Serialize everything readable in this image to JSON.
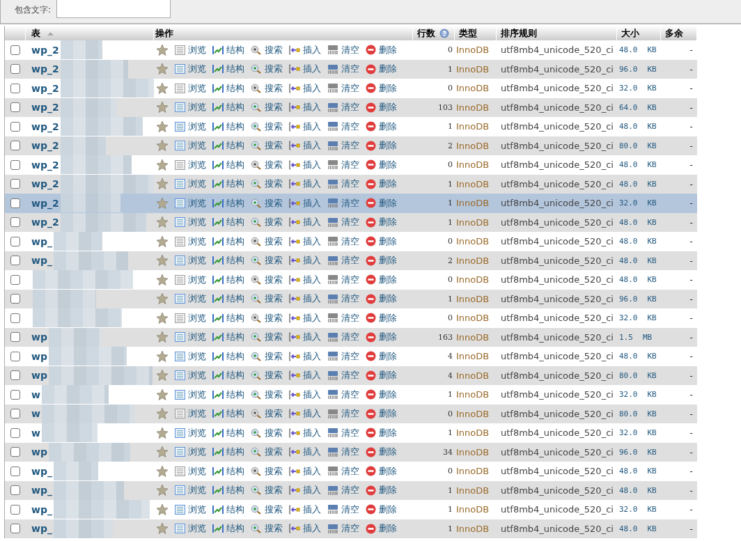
{
  "filter": {
    "label": "包含文字:"
  },
  "table": {
    "columns": [
      {
        "label": "表",
        "kind": "sortable"
      },
      {
        "label": "操作",
        "kind": "plain"
      },
      {
        "label": "行数",
        "kind": "help"
      },
      {
        "label": "类型",
        "kind": "plain"
      },
      {
        "label": "排序规则",
        "kind": "plain"
      },
      {
        "label": "大小",
        "kind": "plain"
      },
      {
        "label": "多余",
        "kind": "plain"
      }
    ],
    "rows": [
      {
        "name": "wp_2",
        "checked": false,
        "hovered": false,
        "empty": true,
        "actions": [
          "浏览",
          "结构",
          "搜索",
          "插入",
          "清空",
          "删除"
        ],
        "rows": "0",
        "type": "InnoDB",
        "collation": "utf8mb4_unicode_520_ci",
        "size": "48.0",
        "unit": "KB",
        "overhead": "-"
      },
      {
        "name": "wp_2",
        "checked": false,
        "hovered": false,
        "empty": false,
        "actions": [
          "浏览",
          "结构",
          "搜索",
          "插入",
          "清空",
          "删除"
        ],
        "rows": "1",
        "type": "InnoDB",
        "collation": "utf8mb4_unicode_520_ci",
        "size": "96.0",
        "unit": "KB",
        "overhead": "-"
      },
      {
        "name": "wp_2",
        "checked": false,
        "hovered": false,
        "empty": true,
        "actions": [
          "浏览",
          "结构",
          "搜索",
          "插入",
          "清空",
          "删除"
        ],
        "rows": "0",
        "type": "InnoDB",
        "collation": "utf8mb4_unicode_520_ci",
        "size": "32.0",
        "unit": "KB",
        "overhead": "-"
      },
      {
        "name": "wp_2",
        "checked": false,
        "hovered": false,
        "empty": false,
        "actions": [
          "浏览",
          "结构",
          "搜索",
          "插入",
          "清空",
          "删除"
        ],
        "rows": "103",
        "type": "InnoDB",
        "collation": "utf8mb4_unicode_520_ci",
        "size": "64.0",
        "unit": "KB",
        "overhead": "-"
      },
      {
        "name": "wp_2",
        "checked": false,
        "hovered": false,
        "empty": false,
        "actions": [
          "浏览",
          "结构",
          "搜索",
          "插入",
          "清空",
          "删除"
        ],
        "rows": "1",
        "type": "InnoDB",
        "collation": "utf8mb4_unicode_520_ci",
        "size": "48.0",
        "unit": "KB",
        "overhead": "-"
      },
      {
        "name": "wp_2",
        "checked": false,
        "hovered": false,
        "empty": false,
        "actions": [
          "浏览",
          "结构",
          "搜索",
          "插入",
          "清空",
          "删除"
        ],
        "rows": "2",
        "type": "InnoDB",
        "collation": "utf8mb4_unicode_520_ci",
        "size": "80.0",
        "unit": "KB",
        "overhead": "-"
      },
      {
        "name": "wp_2",
        "checked": false,
        "hovered": false,
        "empty": true,
        "actions": [
          "浏览",
          "结构",
          "搜索",
          "插入",
          "清空",
          "删除"
        ],
        "rows": "0",
        "type": "InnoDB",
        "collation": "utf8mb4_unicode_520_ci",
        "size": "48.0",
        "unit": "KB",
        "overhead": "-"
      },
      {
        "name": "wp_2",
        "checked": false,
        "hovered": false,
        "empty": false,
        "actions": [
          "浏览",
          "结构",
          "搜索",
          "插入",
          "清空",
          "删除"
        ],
        "rows": "1",
        "type": "InnoDB",
        "collation": "utf8mb4_unicode_520_ci",
        "size": "48.0",
        "unit": "KB",
        "overhead": "-"
      },
      {
        "name": "wp_2",
        "checked": false,
        "hovered": true,
        "empty": false,
        "actions": [
          "浏览",
          "结构",
          "搜索",
          "插入",
          "清空",
          "删除"
        ],
        "rows": "1",
        "type": "InnoDB",
        "collation": "utf8mb4_unicode_520_ci",
        "size": "32.0",
        "unit": "KB",
        "overhead": "-"
      },
      {
        "name": "wp_2",
        "checked": false,
        "hovered": false,
        "empty": false,
        "actions": [
          "浏览",
          "结构",
          "搜索",
          "插入",
          "清空",
          "删除"
        ],
        "rows": "1",
        "type": "InnoDB",
        "collation": "utf8mb4_unicode_520_ci",
        "size": "48.0",
        "unit": "KB",
        "overhead": "-"
      },
      {
        "name": "wp_",
        "checked": false,
        "hovered": false,
        "empty": true,
        "actions": [
          "浏览",
          "结构",
          "搜索",
          "插入",
          "清空",
          "删除"
        ],
        "rows": "0",
        "type": "InnoDB",
        "collation": "utf8mb4_unicode_520_ci",
        "size": "48.0",
        "unit": "KB",
        "overhead": "-"
      },
      {
        "name": "wp_",
        "checked": false,
        "hovered": false,
        "empty": false,
        "actions": [
          "浏览",
          "结构",
          "搜索",
          "插入",
          "清空",
          "删除"
        ],
        "rows": "2",
        "type": "InnoDB",
        "collation": "utf8mb4_unicode_520_ci",
        "size": "48.0",
        "unit": "KB",
        "overhead": "-"
      },
      {
        "checked": false,
        "hovered": false,
        "empty": true,
        "actions": [
          "浏览",
          "结构",
          "搜索",
          "插入",
          "清空",
          "删除"
        ],
        "rows": "0",
        "type": "InnoDB",
        "collation": "utf8mb4_unicode_520_ci",
        "size": "48.0",
        "unit": "KB",
        "overhead": "-"
      },
      {
        "checked": false,
        "hovered": false,
        "empty": false,
        "actions": [
          "浏览",
          "结构",
          "搜索",
          "插入",
          "清空",
          "删除"
        ],
        "rows": "1",
        "type": "InnoDB",
        "collation": "utf8mb4_unicode_520_ci",
        "size": "96.0",
        "unit": "KB",
        "overhead": "-"
      },
      {
        "checked": false,
        "hovered": false,
        "empty": true,
        "actions": [
          "浏览",
          "结构",
          "搜索",
          "插入",
          "清空",
          "删除"
        ],
        "rows": "0",
        "type": "InnoDB",
        "collation": "utf8mb4_unicode_520_ci",
        "size": "32.0",
        "unit": "KB",
        "overhead": "-"
      },
      {
        "name": "wp",
        "checked": false,
        "hovered": false,
        "empty": false,
        "actions": [
          "浏览",
          "结构",
          "搜索",
          "插入",
          "清空",
          "删除"
        ],
        "rows": "163",
        "type": "InnoDB",
        "collation": "utf8mb4_unicode_520_ci",
        "size": "1.5",
        "unit": "MB",
        "overhead": "-"
      },
      {
        "name": "wp",
        "checked": false,
        "hovered": false,
        "empty": false,
        "actions": [
          "浏览",
          "结构",
          "搜索",
          "插入",
          "清空",
          "删除"
        ],
        "rows": "4",
        "type": "InnoDB",
        "collation": "utf8mb4_unicode_520_ci",
        "size": "48.0",
        "unit": "KB",
        "overhead": "-"
      },
      {
        "name": "wp",
        "checked": false,
        "hovered": false,
        "empty": false,
        "actions": [
          "浏览",
          "结构",
          "搜索",
          "插入",
          "清空",
          "删除"
        ],
        "rows": "4",
        "type": "InnoDB",
        "collation": "utf8mb4_unicode_520_ci",
        "size": "80.0",
        "unit": "KB",
        "overhead": "-"
      },
      {
        "name": "w",
        "checked": false,
        "hovered": false,
        "empty": false,
        "actions": [
          "浏览",
          "结构",
          "搜索",
          "插入",
          "清空",
          "删除"
        ],
        "rows": "1",
        "type": "InnoDB",
        "collation": "utf8mb4_unicode_520_ci",
        "size": "32.0",
        "unit": "KB",
        "overhead": "-"
      },
      {
        "name": "w",
        "checked": false,
        "hovered": false,
        "empty": true,
        "actions": [
          "浏览",
          "结构",
          "搜索",
          "插入",
          "清空",
          "删除"
        ],
        "rows": "0",
        "type": "InnoDB",
        "collation": "utf8mb4_unicode_520_ci",
        "size": "80.0",
        "unit": "KB",
        "overhead": "-"
      },
      {
        "name": "w",
        "checked": false,
        "hovered": false,
        "empty": false,
        "actions": [
          "浏览",
          "结构",
          "搜索",
          "插入",
          "清空",
          "删除"
        ],
        "rows": "1",
        "type": "InnoDB",
        "collation": "utf8mb4_unicode_520_ci",
        "size": "32.0",
        "unit": "KB",
        "overhead": "-"
      },
      {
        "name": "wp",
        "checked": false,
        "hovered": false,
        "empty": false,
        "actions": [
          "浏览",
          "结构",
          "搜索",
          "插入",
          "清空",
          "删除"
        ],
        "rows": "34",
        "type": "InnoDB",
        "collation": "utf8mb4_unicode_520_ci",
        "size": "96.0",
        "unit": "KB",
        "overhead": "-"
      },
      {
        "name": "wp_",
        "checked": false,
        "hovered": false,
        "empty": true,
        "actions": [
          "浏览",
          "结构",
          "搜索",
          "插入",
          "清空",
          "删除"
        ],
        "rows": "0",
        "type": "InnoDB",
        "collation": "utf8mb4_unicode_520_ci",
        "size": "48.0",
        "unit": "KB",
        "overhead": "-"
      },
      {
        "name": "wp_",
        "checked": false,
        "hovered": false,
        "empty": false,
        "actions": [
          "浏览",
          "结构",
          "搜索",
          "插入",
          "清空",
          "删除"
        ],
        "rows": "1",
        "type": "InnoDB",
        "collation": "utf8mb4_unicode_520_ci",
        "size": "48.0",
        "unit": "KB",
        "overhead": "-"
      },
      {
        "name": "wp_",
        "checked": false,
        "hovered": false,
        "empty": false,
        "actions": [
          "浏览",
          "结构",
          "搜索",
          "插入",
          "清空",
          "删除"
        ],
        "rows": "1",
        "type": "InnoDB",
        "collation": "utf8mb4_unicode_520_ci",
        "size": "32.0",
        "unit": "KB",
        "overhead": "-"
      },
      {
        "name": "wp_",
        "checked": false,
        "hovered": false,
        "empty": false,
        "actions": [
          "浏览",
          "结构",
          "搜索",
          "插入",
          "清空",
          "删除"
        ],
        "rows": "1",
        "type": "InnoDB",
        "collation": "utf8mb4_unicode_520_ci",
        "size": "48.0",
        "unit": "KB",
        "overhead": "-"
      }
    ]
  }
}
